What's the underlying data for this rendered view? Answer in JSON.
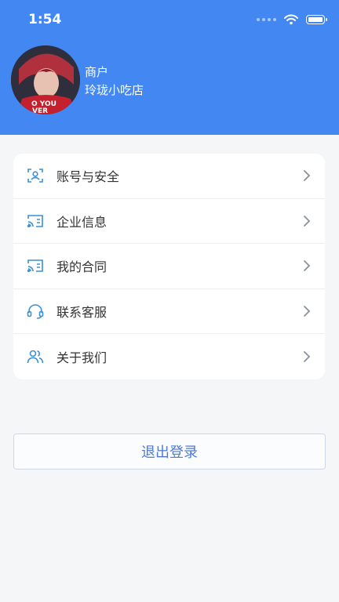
{
  "status": {
    "time": "1:54"
  },
  "profile": {
    "role": "商户",
    "name": "玲珑小吃店",
    "shirt_text_1": "O YOU",
    "shirt_text_2": "VER"
  },
  "menu": {
    "items": [
      {
        "label": "账号与安全",
        "icon": "account-security-icon"
      },
      {
        "label": "企业信息",
        "icon": "cast-screen-icon"
      },
      {
        "label": "我的合同",
        "icon": "cast-screen-icon"
      },
      {
        "label": "联系客服",
        "icon": "headset-icon"
      },
      {
        "label": "关于我们",
        "icon": "users-icon"
      }
    ]
  },
  "logout": {
    "label": "退出登录"
  },
  "colors": {
    "primary": "#4387f2",
    "icon": "#3a8fd6",
    "logout_text": "#4c7ad6"
  }
}
